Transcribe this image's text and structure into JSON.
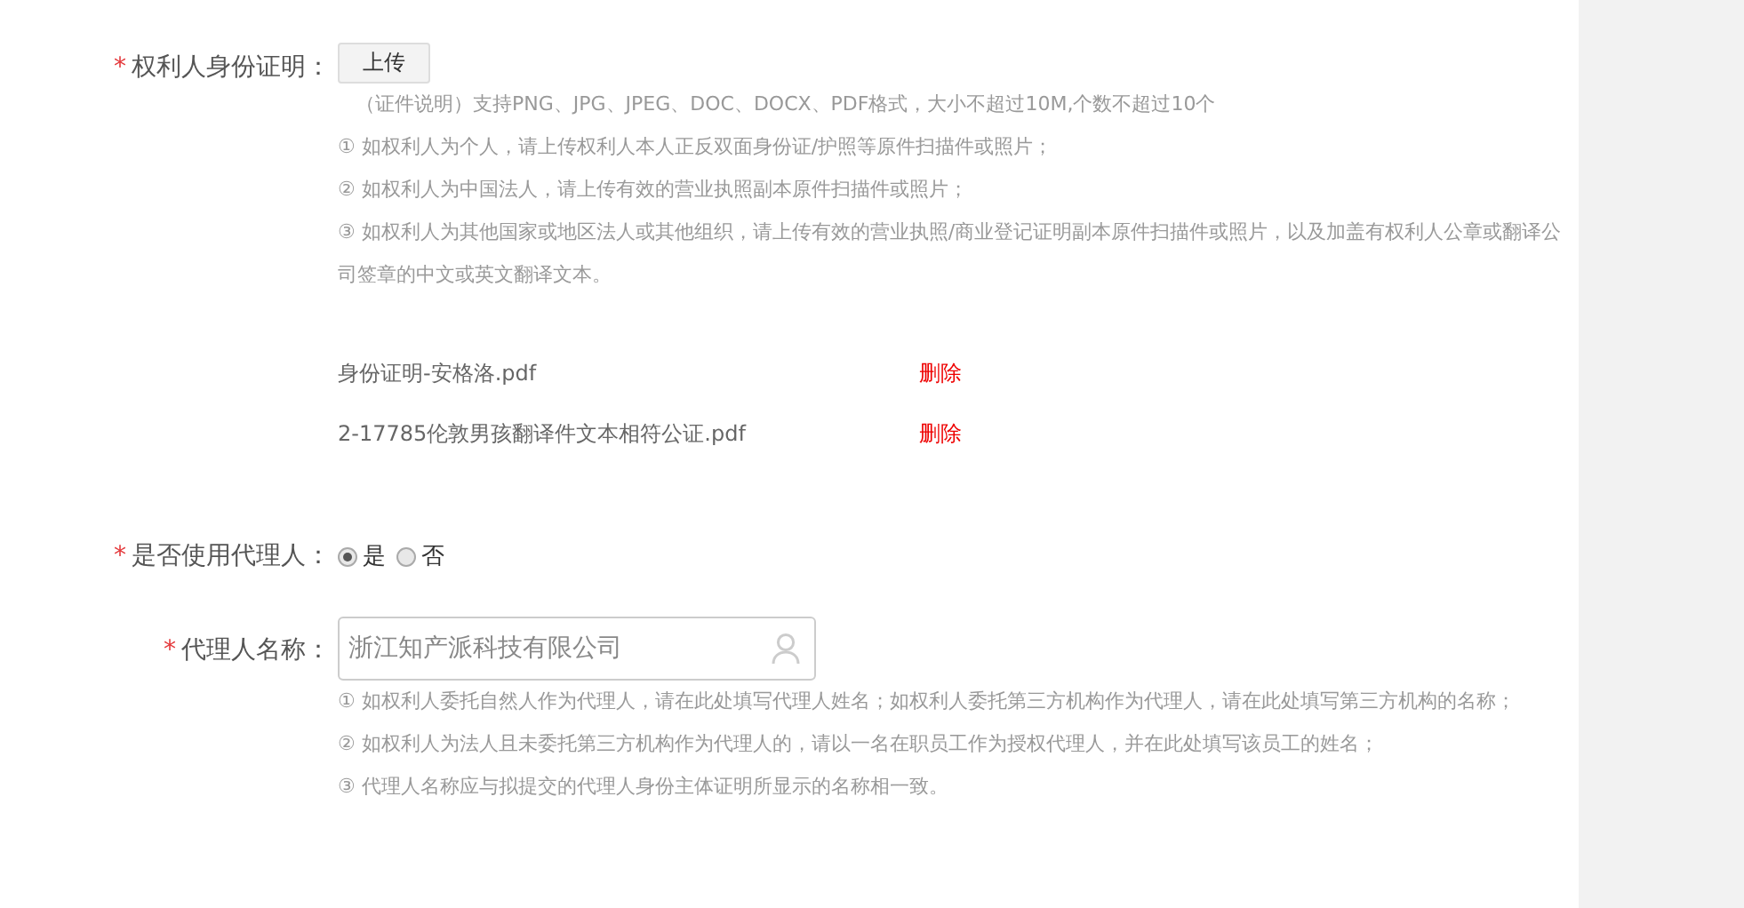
{
  "id_proof": {
    "label": "权利人身份证明：",
    "required_mark": "*",
    "upload_button": "上传",
    "notes": [
      "（证件说明）支持PNG、JPG、JPEG、DOC、DOCX、PDF格式，大小不超过10M,个数不超过10个",
      "① 如权利人为个人，请上传权利人本人正反双面身份证/护照等原件扫描件或照片；",
      "② 如权利人为中国法人，请上传有效的营业执照副本原件扫描件或照片；",
      "③ 如权利人为其他国家或地区法人或其他组织，请上传有效的营业执照/商业登记证明副本原件扫描件或照片，以及加盖有权利人公章或翻译公司签章的中文或英文翻译文本。"
    ],
    "files": [
      {
        "name": "身份证明-安格洛.pdf",
        "action": "删除"
      },
      {
        "name": "2-17785伦敦男孩翻译件文本相符公证.pdf",
        "action": "删除"
      }
    ]
  },
  "use_agent": {
    "label": "是否使用代理人：",
    "required_mark": "*",
    "options": [
      {
        "label": "是",
        "selected": true
      },
      {
        "label": "否",
        "selected": false
      }
    ]
  },
  "agent_name": {
    "label": "代理人名称：",
    "required_mark": "*",
    "value": "浙江知产派科技有限公司",
    "notes": [
      "① 如权利人委托自然人作为代理人，请在此处填写代理人姓名；如权利人委托第三方机构作为代理人，请在此处填写第三方机构的名称；",
      "② 如权利人为法人且未委托第三方机构作为代理人的，请以一名在职员工作为授权代理人，并在此处填写该员工的姓名；",
      "③ 代理人名称应与拟提交的代理人身份主体证明所显示的名称相一致。"
    ]
  }
}
